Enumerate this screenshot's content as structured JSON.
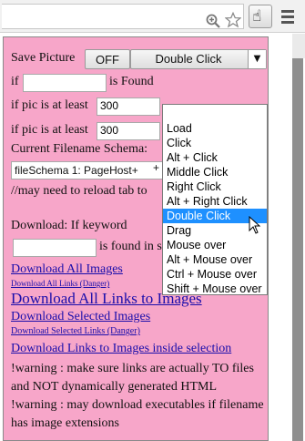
{
  "browser": {
    "zoom_icon": "magnifier-icon",
    "star_icon": "star-icon",
    "extension_icon": "hand-cursor-icon",
    "menu_icon": "hamburger-menu-icon"
  },
  "popup": {
    "save_picture_label": "Save Picture",
    "off_button": "OFF",
    "trigger_selected": "Double Click",
    "if_label": "if",
    "is_found_label": "is Found",
    "if_pic_least_1": "if pic is at least",
    "min_width_value": "300",
    "if_pic_least_2": "if pic is at least",
    "min_height_value": "300",
    "schema_label": "Current Filename Schema:",
    "schema_value": "fileSchema 1: PageHost+",
    "plus_sign": "+",
    "reload_note": "//may need to reload tab to",
    "download_keyword_label": "Download: If keyword",
    "is_found_in_label": "is found in s",
    "links": {
      "download_all_images": "Download All Images",
      "download_all_links_danger": "Download All Links (Danger)",
      "download_all_links_to_images": "Download All Links to Images",
      "download_selected_images": "Download Selected Images",
      "download_selected_links_danger": "Download Selected Links (Danger)",
      "download_links_inside_selection": "Download Links to Images inside selection"
    },
    "warning_1": "!warning : make sure links are actually TO files and NOT dynamically generated HTML",
    "warning_2": "!warning : may download executables if filename has image extensions"
  },
  "dropdown": {
    "options": [
      "Load",
      "Click",
      "Alt + Click",
      "Middle Click",
      "Right Click",
      "Alt + Right Click",
      "Double Click",
      "Drag",
      "Mouse over",
      "Alt + Mouse over",
      "Ctrl + Mouse over",
      "Shift + Mouse over"
    ],
    "selected": "Double Click"
  },
  "colors": {
    "popup_bg": "#f7a6c9",
    "link": "#1a0dab",
    "selection": "#1e90ff"
  }
}
